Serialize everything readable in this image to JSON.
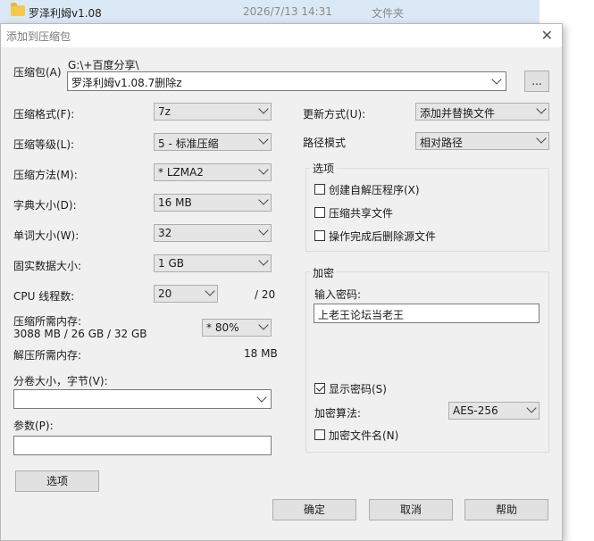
{
  "background_row": {
    "name": "罗泽利姆v1.08",
    "date": "2026/7/13 14:31",
    "type": "文件夹"
  },
  "dialog": {
    "title": "添加到压缩包",
    "close": "✕"
  },
  "archive": {
    "label": "压缩包(A)",
    "path": "G:\\+百度分享\\",
    "value": "罗泽利姆v1.08.7删除z",
    "browse": "..."
  },
  "format": {
    "label": "压缩格式(F):",
    "value": "7z"
  },
  "level": {
    "label": "压缩等级(L):",
    "value": "5 - 标准压缩"
  },
  "method": {
    "label": "压缩方法(M):",
    "value": "* LZMA2"
  },
  "dict": {
    "label": "字典大小(D):",
    "value": "16 MB"
  },
  "word": {
    "label": "单词大小(W):",
    "value": "32"
  },
  "solid": {
    "label": "固实数据大小:",
    "value": "1 GB"
  },
  "cpu": {
    "label": "CPU 线程数:",
    "value": "20",
    "total": "/ 20"
  },
  "mem_comp": {
    "label": "压缩所需内存:",
    "detail": "3088 MB / 26 GB / 32 GB",
    "value": "* 80%"
  },
  "mem_decomp": {
    "label": "解压所需内存:",
    "value": "18 MB"
  },
  "volume": {
    "label": "分卷大小，字节(V):",
    "value": ""
  },
  "params": {
    "label": "参数(P):",
    "value": ""
  },
  "options_button": "选项",
  "update": {
    "label": "更新方式(U):",
    "value": "添加并替换文件"
  },
  "path_mode": {
    "label": "路径模式",
    "value": "相对路径"
  },
  "options_group": {
    "title": "选项",
    "items": [
      {
        "label": "创建自解压程序(X)",
        "checked": false
      },
      {
        "label": "压缩共享文件",
        "checked": false
      },
      {
        "label": "操作完成后删除源文件",
        "checked": false
      }
    ]
  },
  "encryption": {
    "title": "加密",
    "password_label": "输入密码:",
    "password_value": "上老王论坛当老王",
    "show_password": {
      "label": "显示密码(S)",
      "checked": true
    },
    "method_label": "加密算法:",
    "method_value": "AES-256",
    "encrypt_names": {
      "label": "加密文件名(N)",
      "checked": false
    }
  },
  "buttons": {
    "ok": "确定",
    "cancel": "取消",
    "help": "帮助"
  }
}
